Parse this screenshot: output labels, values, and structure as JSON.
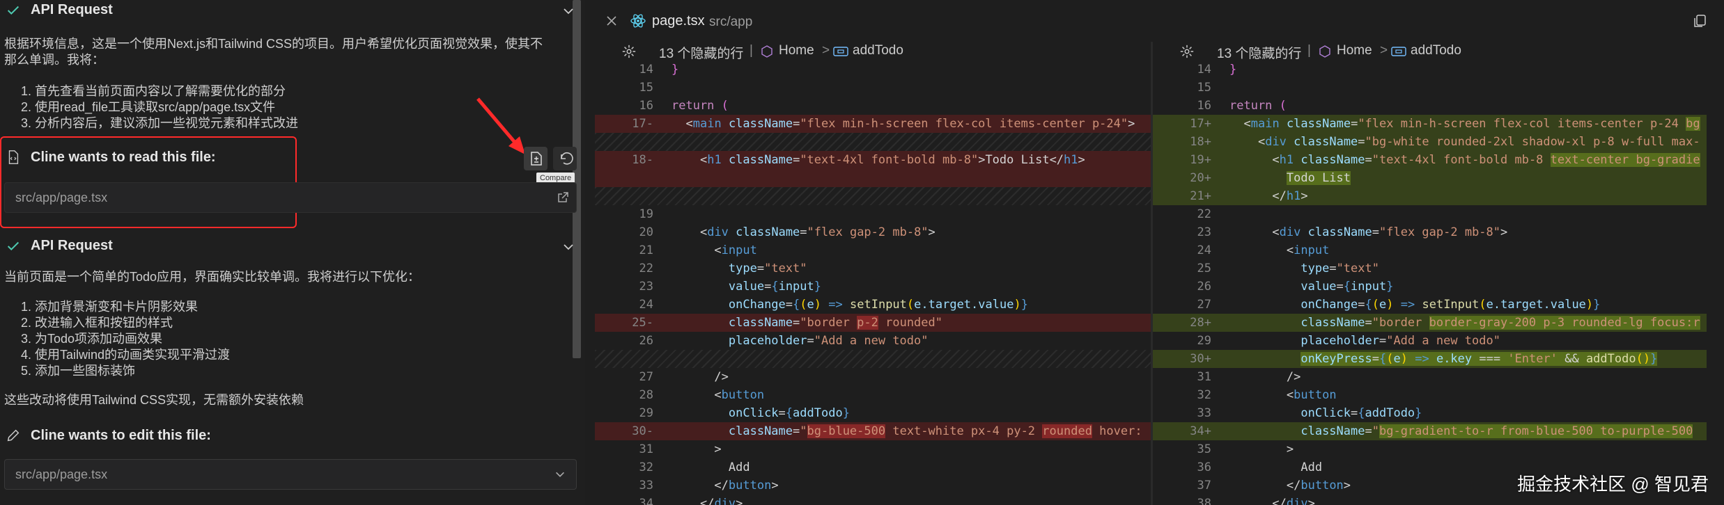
{
  "chat": {
    "api_request_title": "API Request",
    "intro_text": "根据环境信息，这是一个使用Next.js和Tailwind CSS的项目。用户希望优化页面视觉效果，使其不那么单调。我将：",
    "intro_text_line1": "根据环境信息，这是一个使用Next.js和Tailwind CSS的项目。用户希望优化页面视觉效果，使其不",
    "intro_text_line2": "那么单调。我将：",
    "plan_steps": [
      "1. 首先查看当前页面内容以了解需要优化的部分",
      "2. 使用read_file工具读取src/app/page.tsx文件",
      "3. 分析内容后，建议添加一些视觉元素和样式改进"
    ],
    "read_title": "Cline wants to read this file:",
    "read_path": "src/app/page.tsx",
    "compare_tooltip": "Compare",
    "api_request_title_2": "API Request",
    "analysis_text": "当前页面是一个简单的Todo应用，界面确实比较单调。我将进行以下优化：",
    "optimizations": [
      "1. 添加背景渐变和卡片阴影效果",
      "2. 改进输入框和按钮的样式",
      "3. 为Todo项添加动画效果",
      "4. 使用Tailwind的动画类实现平滑过渡",
      "5. 添加一些图标装饰"
    ],
    "summary_text": "这些改动将使用Tailwind CSS实现，无需额外安装依赖",
    "edit_title": "Cline wants to edit this file:",
    "edit_path": "src/app/page.tsx"
  },
  "editor": {
    "tab_name": "page.tsx",
    "tab_path": "src/app",
    "hidden_lines": "13 个隐藏的行",
    "crumb_sep": "|",
    "crumb_home": "Home",
    "crumb_arrow": ">",
    "crumb_fn": "addTodo",
    "left_numbers": [
      "14",
      "15",
      "16",
      "17-",
      "",
      "18-",
      "",
      "",
      "19",
      "20",
      "21",
      "22",
      "23",
      "24",
      "25-",
      "26",
      "",
      "27",
      "28",
      "29",
      "30-",
      "31",
      "32",
      "33",
      "34"
    ],
    "right_numbers": [
      "14",
      "15",
      "16",
      "17+",
      "18+",
      "19+",
      "20+",
      "21+",
      "22",
      "23",
      "24",
      "25",
      "26",
      "27",
      "28+",
      "29",
      "30+",
      "31",
      "32",
      "33",
      "34+",
      "35",
      "36",
      "37",
      "38"
    ]
  },
  "watermark": "掘金技术社区 @ 智见君",
  "colors": {
    "deletion": "#5a2323",
    "addition": "#4b5f19",
    "highlight_red": "#ff2a2a"
  }
}
